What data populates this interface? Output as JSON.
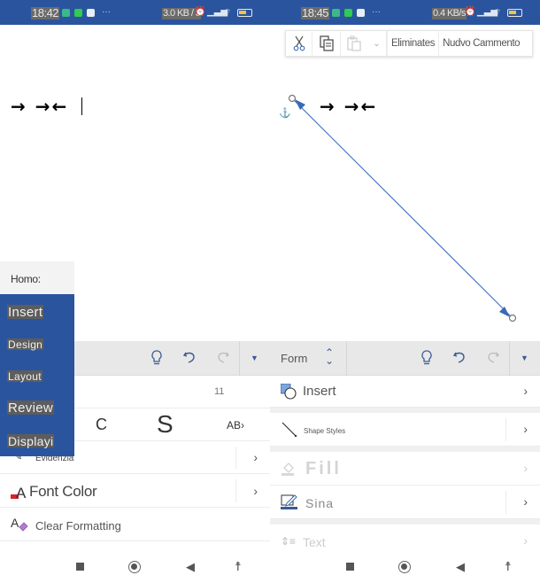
{
  "left": {
    "status": {
      "time": "18:42",
      "speed": "3.0 KB / 3",
      "battery_level": 0.4
    },
    "document": {
      "content": "→ →←"
    },
    "side_menu": {
      "home": "Homo:",
      "items": [
        {
          "label": "Insert"
        },
        {
          "label": "Design"
        },
        {
          "label": "Layout"
        },
        {
          "label": "Review"
        },
        {
          "label": "Displayi"
        }
      ]
    },
    "toolbar": {
      "icons": [
        "lightbulb-icon",
        "undo-icon",
        "redo-icon",
        "dropdown-icon"
      ]
    },
    "font_size": "11",
    "format_buttons": {
      "italic": "C",
      "underline": "S",
      "strikethrough": "AB"
    },
    "rows": {
      "highlight": "Evidenzia",
      "font_color": "Font Color",
      "clear_formatting": "Clear Formatting"
    }
  },
  "right": {
    "status": {
      "time": "18:45",
      "speed": "0.4 KB/s",
      "battery_level": 0.4
    },
    "context_menu": {
      "delete": "Eliminates",
      "new_comment": "Nudvo Cammento"
    },
    "document": {
      "content": "→ →←"
    },
    "toolbar": {
      "tab_label": "Form"
    },
    "rows": {
      "insert": "Insert",
      "shape_styles": "Shape Styles",
      "fill": "Fill",
      "line": "Sina",
      "text": "Text"
    }
  },
  "colors": {
    "status_bar": "#2a559e",
    "accent_blue": "#3a5a94",
    "font_color_red": "#d8232a",
    "eraser_purple": "#b07cd0",
    "line_shape": "#4a78bf"
  }
}
